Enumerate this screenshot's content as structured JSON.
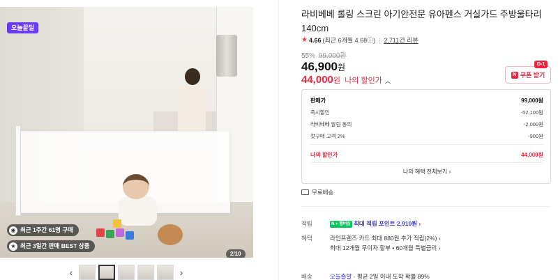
{
  "gallery": {
    "badge": "오늘끝딜",
    "pills": [
      {
        "icon": "cart-icon",
        "text": "최근 1주간 61명 구매"
      },
      {
        "icon": "trophy-icon",
        "text": "최근 3일간 판매 BEST 상품"
      }
    ],
    "counter": "2/10",
    "prev": "‹",
    "next": "›",
    "thumb_count": 5,
    "active_thumb": 2
  },
  "product": {
    "title": "라비베베 롤링 스크린 아기안전문 유아펜스 거실가드 주방울타리 140cm",
    "rating": "4.66",
    "rating_detail": "(최근 6개월 4.68ⓘ)",
    "review_count": "2,711건 리뷰",
    "discount_pct": "55%",
    "original_price": "99,000원",
    "sale_price": "46,900",
    "won": "원",
    "my_price": "44,000",
    "my_price_label": "나의 할인가",
    "coupon_label": "쿠폰 받기",
    "coupon_deadline": "D-1"
  },
  "benefits": {
    "rows": [
      {
        "label": "판매가",
        "value": "99,000원"
      },
      {
        "label": "즉시할인",
        "value": "-52,100원"
      },
      {
        "label": "라비베베 알림 동의",
        "value": "-2,000원"
      },
      {
        "label": "첫구매 고객 2%",
        "value": "-900원"
      },
      {
        "label": "나의 할인가",
        "value": "44,000원"
      }
    ],
    "view_all": "나의 혜택 전체보기 ›"
  },
  "shipping": {
    "free": "무료배송"
  },
  "details": {
    "points_label": "적립",
    "points_badge": "N + 멤버십",
    "points_text": "최대 적립 포인트 2,910원 ›",
    "benefit_label": "혜택",
    "benefit_line1": "라인프렌즈 카드 최대 880원 추가 적립(2%) ›",
    "benefit_line2": "최대 12개월 무이자 할부 • 60개월 특별금리 ›",
    "delivery_label": "배송",
    "delivery_today": "오늘출발",
    "delivery_text": "평균 2일 이내 도착 확률 89%"
  },
  "colors": {
    "accent": "#e8263c",
    "badge": "#6a3df5",
    "npay": "#03c75a",
    "point": "#3a3ad6"
  }
}
